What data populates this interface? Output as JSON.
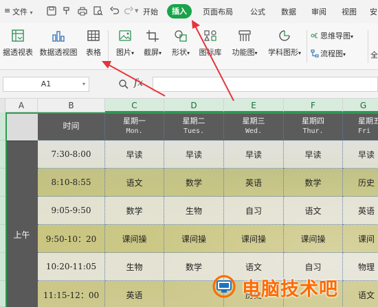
{
  "menubar": {
    "file_label": "文件",
    "tabs": [
      {
        "label": "开始"
      },
      {
        "label": "插入"
      },
      {
        "label": "页面布局"
      },
      {
        "label": "公式"
      },
      {
        "label": "数据"
      },
      {
        "label": "审阅"
      },
      {
        "label": "视图"
      },
      {
        "label": "安"
      }
    ],
    "active_tab": "插入",
    "accent_color": "#1aa34a"
  },
  "ribbon": {
    "buttons": [
      {
        "label": "据透视表",
        "icon": "pivot-table-icon"
      },
      {
        "label": "数据透视图",
        "icon": "pivot-chart-icon"
      },
      {
        "label": "表格",
        "icon": "table-icon"
      },
      {
        "label": "图片",
        "icon": "picture-icon"
      },
      {
        "label": "截屏",
        "icon": "screenshot-icon"
      },
      {
        "label": "形状",
        "icon": "shape-icon"
      },
      {
        "label": "图标库",
        "icon": "icon-library-icon"
      },
      {
        "label": "功能图",
        "icon": "function-chart-icon"
      },
      {
        "label": "学科图形",
        "icon": "subject-graphics-icon"
      }
    ],
    "small_buttons": [
      {
        "label": "思维导图",
        "icon": "mindmap-icon"
      },
      {
        "label": "流程图",
        "icon": "flowchart-icon"
      }
    ],
    "overflow_label": "全"
  },
  "formula_bar": {
    "cell_ref": "A1",
    "fx_label": "fx",
    "value": ""
  },
  "sheet": {
    "columns": [
      "A",
      "B",
      "C",
      "D",
      "E",
      "F",
      "G"
    ],
    "selected_columns": [
      "C",
      "D",
      "E",
      "F",
      "G"
    ],
    "merged_label": "上午",
    "header": {
      "time_label": "时间",
      "days": [
        {
          "cn": "星期一",
          "en": "Mon."
        },
        {
          "cn": "星期二",
          "en": "Tues."
        },
        {
          "cn": "星期三",
          "en": "Wed."
        },
        {
          "cn": "星期四",
          "en": "Thur."
        },
        {
          "cn": "星期五",
          "en": "Fri"
        }
      ]
    },
    "rows": [
      {
        "time": "7:30-8:00",
        "cells": [
          "早读",
          "早读",
          "早读",
          "早读",
          "早读"
        ]
      },
      {
        "time": "8:10-8:55",
        "cells": [
          "语文",
          "数学",
          "英语",
          "数学",
          "历史"
        ]
      },
      {
        "time": "9:05-9:50",
        "cells": [
          "数学",
          "生物",
          "自习",
          "语文",
          "英语"
        ]
      },
      {
        "time": "9:50-10：20",
        "cells": [
          "课间操",
          "课间操",
          "课间操",
          "课间操",
          "课间"
        ]
      },
      {
        "time": "10:20-11:05",
        "cells": [
          "生物",
          "数学",
          "语文",
          "自习",
          "物理"
        ]
      },
      {
        "time": "11:15-12：00",
        "cells": [
          "英语",
          "",
          "历史",
          "",
          "语文"
        ]
      }
    ]
  },
  "watermark": {
    "text": "电脑技术吧",
    "color": "#ff6a00"
  }
}
